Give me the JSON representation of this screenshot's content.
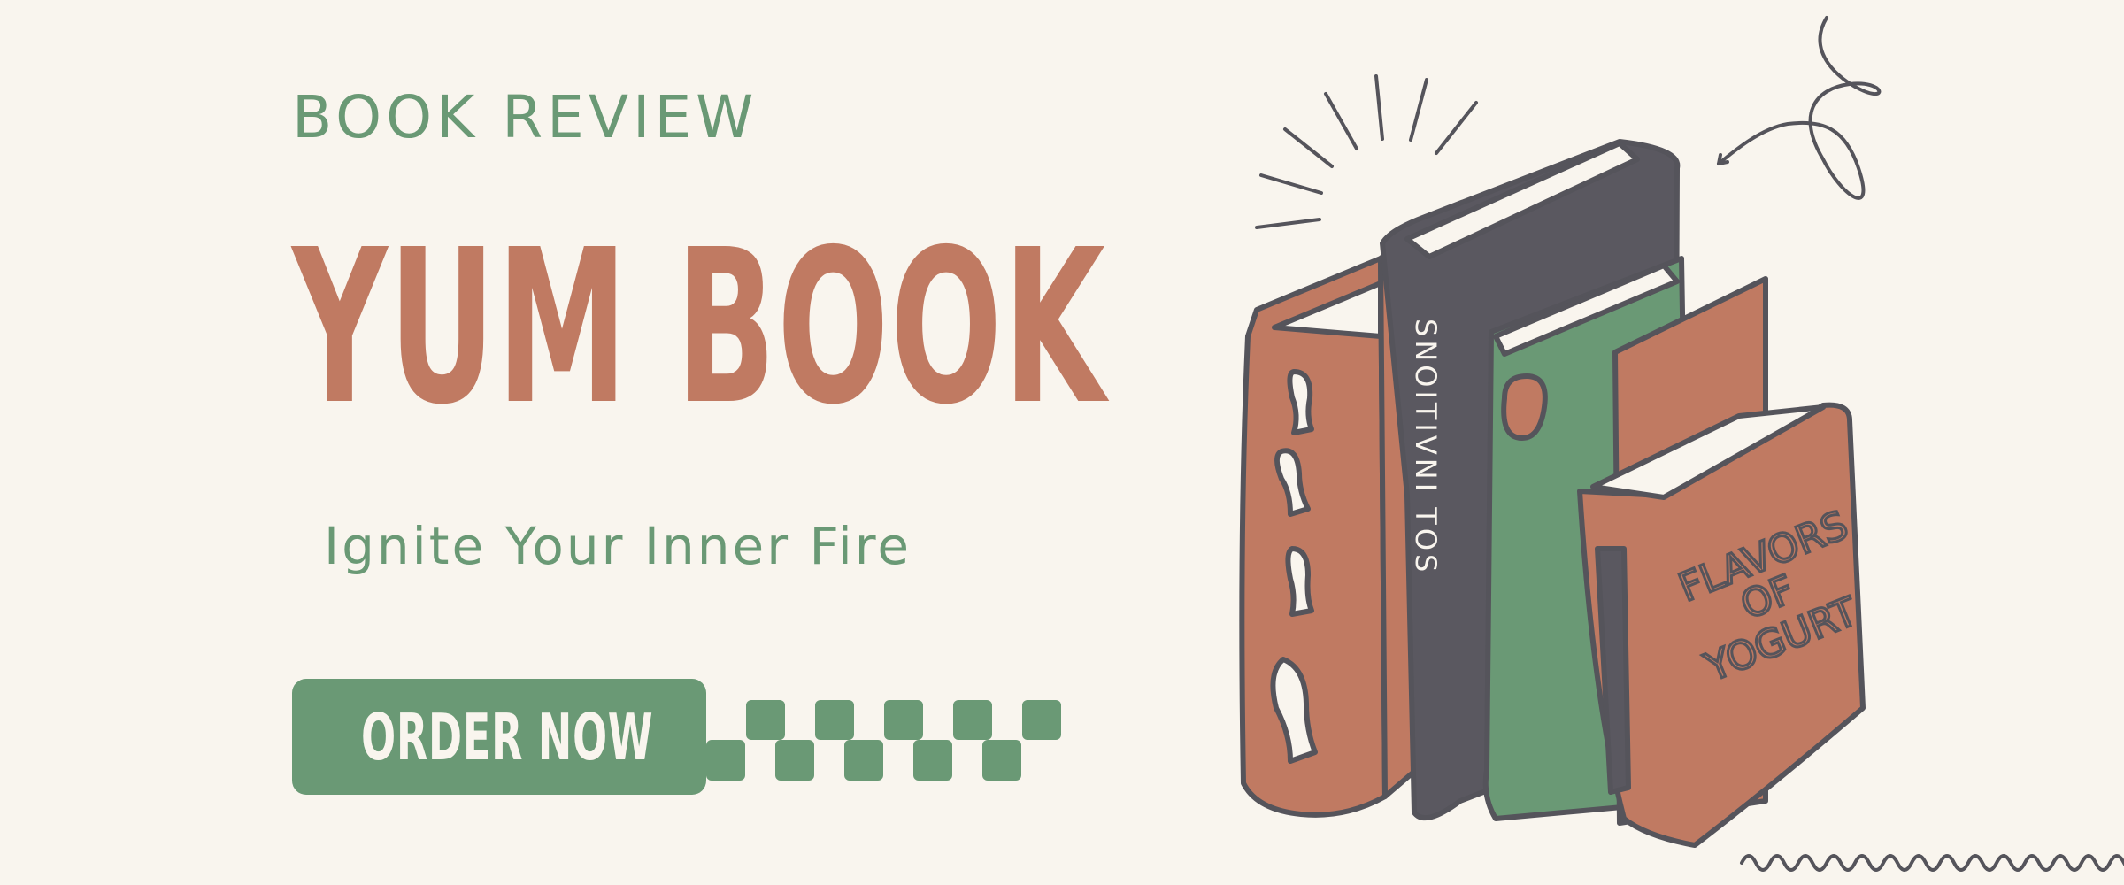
{
  "banner": {
    "eyebrow": "BOOK REVIEW",
    "title": "YUM BOOK",
    "tagline": "Ignite Your Inner Fire",
    "cta_label": "ORDER NOW"
  },
  "illustration": {
    "spine_text": "SNOITIVNI TOS",
    "cover_text_line1": "FLAVORS",
    "cover_text_line2": "OF",
    "cover_text_line3": "YOGURT"
  },
  "colors": {
    "background": "#f9f5ee",
    "terracotta": "#c07a62",
    "sage": "#6a9975",
    "charcoal": "#5a5860",
    "outline": "#55545b"
  }
}
